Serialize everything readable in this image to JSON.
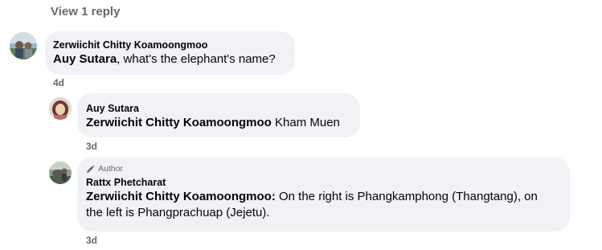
{
  "view_replies_label": "View 1 reply",
  "comments": [
    {
      "author": "Zerwiichit Chitty Koamoongmoo",
      "mention": "Auy Sutara",
      "text": ", what's the elephant's name?",
      "time": "4d"
    },
    {
      "author": "Auy Sutara",
      "mention": "Zerwiichit Chitty Koamoongmoo",
      "text": " Kham Muen",
      "time": "3d"
    },
    {
      "badge": "Author",
      "author": "Rattx Phetcharat",
      "mention": "Zerwiichit Chitty Koamoongmoo:",
      "text": " On the right is Phangkamphong (Thangtang), on the left is Phangprachuap (Jejetu).",
      "time": "3d"
    }
  ],
  "icons": {
    "badge": "pencil-icon"
  },
  "colors": {
    "bubble": "#f0f2f5",
    "secondary_text": "#65676b",
    "primary_text": "#050505"
  }
}
